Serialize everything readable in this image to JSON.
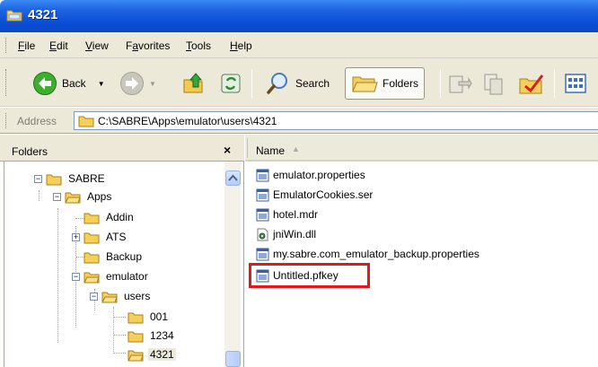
{
  "window": {
    "title": "4321"
  },
  "menu": [
    {
      "label": "File",
      "accel": "F",
      "rest": "ile"
    },
    {
      "label": "Edit",
      "accel": "E",
      "rest": "dit"
    },
    {
      "label": "View",
      "accel": "V",
      "rest": "iew"
    },
    {
      "label": "Favorites",
      "accel": "a",
      "pre": "F",
      "rest": "vorites"
    },
    {
      "label": "Tools",
      "accel": "T",
      "rest": "ools"
    },
    {
      "label": "Help",
      "accel": "H",
      "rest": "elp"
    }
  ],
  "toolbar": {
    "back_label": "Back",
    "search_label": "Search",
    "folders_label": "Folders"
  },
  "address": {
    "label": "Address",
    "path": "C:\\SABRE\\Apps\\emulator\\users\\4321"
  },
  "folders_pane": {
    "title": "Folders",
    "close": "×",
    "tree": [
      {
        "label": "SABRE"
      },
      {
        "label": "Apps"
      },
      {
        "label": "Addin"
      },
      {
        "label": "ATS"
      },
      {
        "label": "Backup"
      },
      {
        "label": "emulator"
      },
      {
        "label": "users"
      },
      {
        "label": "001"
      },
      {
        "label": "1234"
      },
      {
        "label": "4321"
      }
    ]
  },
  "files_pane": {
    "column_name": "Name",
    "files": [
      {
        "name": "emulator.properties",
        "icon": "properties-file-icon"
      },
      {
        "name": "EmulatorCookies.ser",
        "icon": "ser-file-icon"
      },
      {
        "name": "hotel.mdr",
        "icon": "mdr-file-icon"
      },
      {
        "name": "jniWin.dll",
        "icon": "dll-file-icon"
      },
      {
        "name": "my.sabre.com_emulator_backup.properties",
        "icon": "properties-file-icon"
      },
      {
        "name": "Untitled.pfkey",
        "icon": "pfkey-file-icon"
      }
    ]
  },
  "colors": {
    "titlebar": "#0a4fd6",
    "chrome": "#ece9d8",
    "highlight": "#e0191f"
  }
}
